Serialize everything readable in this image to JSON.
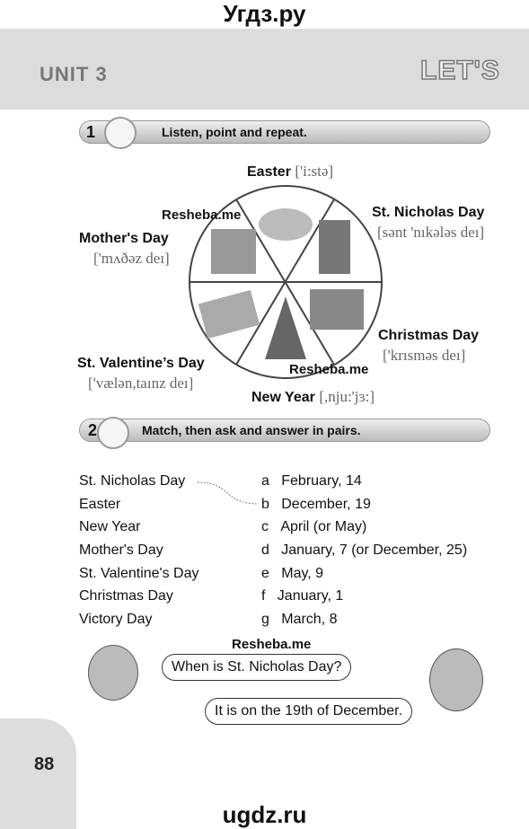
{
  "header": {
    "site": "Угдз.ру",
    "unit": "UNIT 3",
    "lets": "LET'S"
  },
  "exercise1": {
    "number": "1",
    "instruction": "Listen, point and repeat.",
    "holidays": [
      {
        "name": "Easter",
        "phonetic": "['i:stə]"
      },
      {
        "name": "St. Nicholas Day",
        "phonetic": "[sənt 'nıkələs deı]"
      },
      {
        "name": "Mother's Day",
        "phonetic": "['mʌðəz deı]"
      },
      {
        "name": "Christmas Day",
        "phonetic": "['krısməs deı]"
      },
      {
        "name": "St. Valentine’s Day",
        "phonetic": "['vælən,taınz deı]"
      },
      {
        "name": "New Year",
        "phonetic": "[,nju:'jɜ:]"
      }
    ],
    "watermarks": [
      "Resheba.me",
      "Resheba.me"
    ]
  },
  "exercise2": {
    "number": "2",
    "instruction": "Match, then ask and answer in pairs.",
    "holidays": [
      "St. Nicholas Day",
      "Easter",
      "New Year",
      "Mother's Day",
      "St. Valentine's Day",
      "Christmas Day",
      "Victory Day"
    ],
    "dates": [
      {
        "letter": "a",
        "date": "February, 14"
      },
      {
        "letter": "b",
        "date": "December, 19"
      },
      {
        "letter": "c",
        "date": "April (or May)"
      },
      {
        "letter": "d",
        "date": "January, 7 (or December, 25)"
      },
      {
        "letter": "e",
        "date": "May, 9"
      },
      {
        "letter": "f",
        "date": "January, 1"
      },
      {
        "letter": "g",
        "date": "March, 8"
      }
    ],
    "watermark": "Resheba.me",
    "question": "When is St. Nicholas Day?",
    "answer": "It is on the 19th of December."
  },
  "footer": {
    "page": "88",
    "site": "ugdz.ru"
  }
}
